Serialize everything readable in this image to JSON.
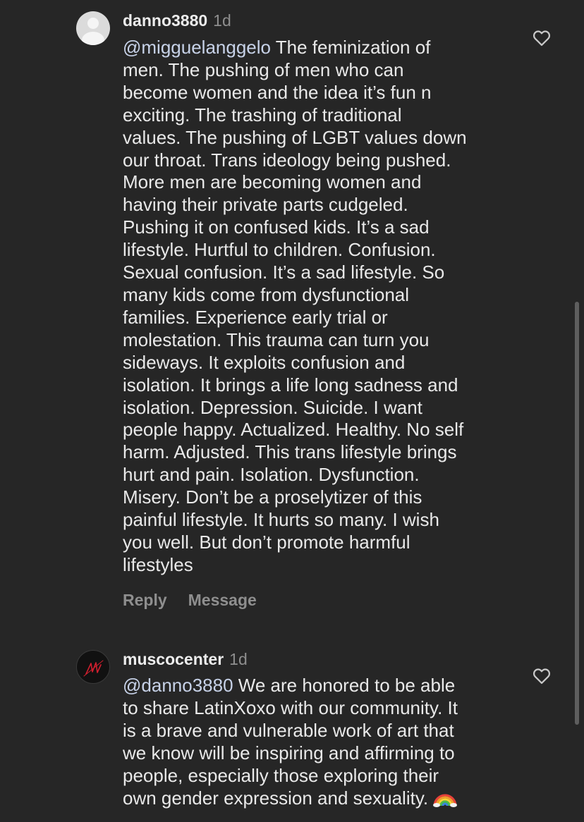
{
  "comments": [
    {
      "username": "danno3880",
      "timestamp": "1d",
      "mention": "@migguelanggelo",
      "text": "  The feminization of\nmen. The pushing of men who can\nbecome women and the idea it’s fun n\nexciting. The trashing of traditional\nvalues. The pushing of LGBT values down\nour throat. Trans ideology being pushed.\nMore men are becoming women and\nhaving their private parts cudgeled.\nPushing it on confused kids. It’s a sad\nlifestyle. Hurtful to children. Confusion.\nSexual confusion. It’s a sad lifestyle. So\nmany kids come from dysfunctional\nfamilies. Experience early trial or\nmolestation. This trauma can turn you\nsideways. It exploits confusion and\nisolation. It brings a life long sadness and\nisolation. Depression. Suicide. I want\npeople happy. Actualized. Healthy. No self\nharm. Adjusted. This trans lifestyle brings\nhurt and pain. Isolation. Dysfunction.\nMisery. Don’t be a proselytizer of this\npainful lifestyle. It hurts so many. I wish\nyou well. But don’t promote harmful\nlifestyles",
      "reply_label": "Reply",
      "message_label": "Message",
      "avatar_icon": "default-avatar-icon",
      "like_icon": "heart-outline-icon"
    },
    {
      "username": "muscocenter",
      "timestamp": "1d",
      "mention": "@danno3880",
      "text": " We are honored to be able\nto share LatinXoxo with our community. It\nis a brave and vulnerable work of art that\nwe know will be inspiring and affirming to\npeople, especially those exploring their\nown gender expression and sexuality.",
      "emoji": "rainbow-emoji",
      "avatar_icon": "brand-logo-avatar-icon",
      "like_icon": "heart-outline-icon"
    }
  ],
  "colors": {
    "background": "#262626",
    "text": "#e9e9e9",
    "muted": "#8e8e8e",
    "mention": "#c7d2e8"
  }
}
